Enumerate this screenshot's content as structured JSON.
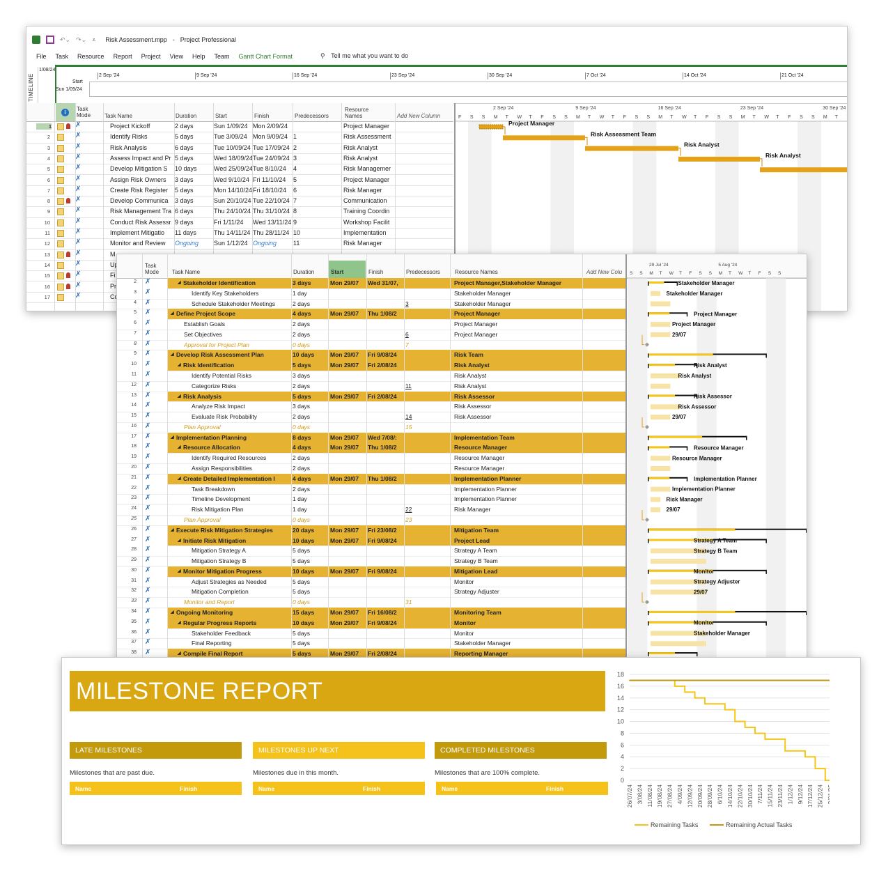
{
  "window1": {
    "doc_title": "Risk Assessment.mpp",
    "separator": "-",
    "app_title": "Project Professional",
    "menu": [
      "File",
      "Task",
      "Resource",
      "Report",
      "Project",
      "View",
      "Help",
      "Team",
      "Gantt Chart Format"
    ],
    "tell_me": "Tell me what you want to do",
    "timeline": {
      "side_label": "TIMELINE",
      "today_label": "1/08/24",
      "start_label": "Start",
      "start_date": "Sun 1/09/24",
      "dates": [
        "2 Sep '24",
        "9 Sep '24",
        "16 Sep '24",
        "23 Sep '24",
        "30 Sep '24",
        "7 Oct '24",
        "14 Oct '24",
        "21 Oct '24"
      ]
    },
    "columns": {
      "task_mode": "Task Mode",
      "task_name": "Task Name",
      "duration": "Duration",
      "start": "Start",
      "finish": "Finish",
      "predecessors": "Predecessors",
      "resource_names": "Resource Names",
      "add_new": "Add New Column"
    },
    "rows": [
      {
        "n": "1",
        "name": "Project Kickoff",
        "dur": "2 days",
        "start": "Sun 1/09/24",
        "finish": "Mon 2/09/24",
        "pred": "",
        "res": "Project Manager"
      },
      {
        "n": "2",
        "name": "Identify Risks",
        "dur": "5 days",
        "start": "Tue 3/09/24",
        "finish": "Mon 9/09/24",
        "pred": "1",
        "res": "Risk Assessment"
      },
      {
        "n": "3",
        "name": "Risk Analysis",
        "dur": "6 days",
        "start": "Tue 10/09/24",
        "finish": "Tue 17/09/24",
        "pred": "2",
        "res": "Risk Analyst"
      },
      {
        "n": "4",
        "name": "Assess Impact and Pr",
        "dur": "5 days",
        "start": "Wed 18/09/24",
        "finish": "Tue 24/09/24",
        "pred": "3",
        "res": "Risk Analyst"
      },
      {
        "n": "5",
        "name": "Develop Mitigation S",
        "dur": "10 days",
        "start": "Wed 25/09/24",
        "finish": "Tue 8/10/24",
        "pred": "4",
        "res": "Risk Managemer"
      },
      {
        "n": "6",
        "name": "Assign Risk Owners",
        "dur": "3 days",
        "start": "Wed 9/10/24",
        "finish": "Fri 11/10/24",
        "pred": "5",
        "res": "Project Manager"
      },
      {
        "n": "7",
        "name": "Create Risk Register",
        "dur": "5 days",
        "start": "Mon 14/10/24",
        "finish": "Fri 18/10/24",
        "pred": "6",
        "res": "Risk Manager"
      },
      {
        "n": "8",
        "name": "Develop Communica",
        "dur": "3 days",
        "start": "Sun 20/10/24",
        "finish": "Tue 22/10/24",
        "pred": "7",
        "res": "Communication"
      },
      {
        "n": "9",
        "name": "Risk Management Tra",
        "dur": "6 days",
        "start": "Thu 24/10/24",
        "finish": "Thu 31/10/24",
        "pred": "8",
        "res": "Training Coordin"
      },
      {
        "n": "10",
        "name": "Conduct Risk Assessr",
        "dur": "9 days",
        "start": "Fri 1/11/24",
        "finish": "Wed 13/11/24",
        "pred": "9",
        "res": "Workshop Facilit"
      },
      {
        "n": "11",
        "name": "Implement Mitigatio",
        "dur": "11 days",
        "start": "Thu 14/11/24",
        "finish": "Thu 28/11/24",
        "pred": "10",
        "res": "Implementation"
      },
      {
        "n": "12",
        "name": "Monitor and Review",
        "dur": "Ongoing",
        "start": "Sun 1/12/24",
        "finish": "Ongoing",
        "pred": "11",
        "res": "Risk Manager"
      },
      {
        "n": "13",
        "name": "M",
        "dur": "",
        "start": "",
        "finish": "",
        "pred": "",
        "res": ""
      },
      {
        "n": "14",
        "name": "Up",
        "dur": "",
        "start": "",
        "finish": "",
        "pred": "",
        "res": ""
      },
      {
        "n": "15",
        "name": "Fi",
        "dur": "",
        "start": "",
        "finish": "",
        "pred": "",
        "res": ""
      },
      {
        "n": "16",
        "name": "Pr",
        "dur": "",
        "start": "",
        "finish": "",
        "pred": "",
        "res": ""
      },
      {
        "n": "17",
        "name": "Co",
        "dur": "",
        "start": "",
        "finish": "",
        "pred": "",
        "res": ""
      }
    ],
    "gantt_weeks": [
      "2 Sep '24",
      "9 Sep '24",
      "16 Sep '24",
      "23 Sep '24",
      "30 Sep '24"
    ],
    "gantt_days": [
      "F",
      "S",
      "S",
      "M",
      "T",
      "W",
      "T",
      "F",
      "S",
      "S",
      "M",
      "T",
      "W",
      "T",
      "F",
      "S",
      "S",
      "M",
      "T",
      "W",
      "T",
      "F",
      "S",
      "S",
      "M",
      "T",
      "W",
      "T",
      "F",
      "S",
      "S",
      "M",
      "T",
      "W"
    ],
    "gantt_labels": [
      "Project Manager",
      "Risk Assessment Team",
      "Risk Analyst",
      "Risk Analyst"
    ]
  },
  "window2": {
    "columns": {
      "task_mode": "Task Mode",
      "task_name": "Task Name",
      "duration": "Duration",
      "start": "Start",
      "finish": "Finish",
      "predecessors": "Predecessors",
      "resource_names": "Resource Names",
      "add_new": "Add New Colu"
    },
    "gantt_weeks": [
      "29 Jul '24",
      "5 Aug '24"
    ],
    "gantt_days": [
      "S",
      "S",
      "M",
      "T",
      "W",
      "T",
      "F",
      "S",
      "S",
      "M",
      "T",
      "W",
      "T",
      "F",
      "S",
      "S"
    ],
    "rows": [
      {
        "n": "2",
        "name": "Stakeholder Identification",
        "dur": "3 days",
        "start": "Mon 29/07",
        "finish": "Wed 31/07,",
        "pred": "",
        "res": "Project Manager,Stakeholder Manager",
        "type": "sum",
        "lvl": 2
      },
      {
        "n": "3",
        "name": "Identify Key Stakeholders",
        "dur": "1 day",
        "start": "",
        "finish": "",
        "pred": "",
        "res": "Stakeholder Manager",
        "type": "task",
        "lvl": 3
      },
      {
        "n": "4",
        "name": "Schedule Stakeholder Meetings",
        "dur": "2 days",
        "start": "",
        "finish": "",
        "pred": "3",
        "res": "Stakeholder Manager",
        "type": "task",
        "lvl": 3
      },
      {
        "n": "5",
        "name": "Define Project Scope",
        "dur": "4 days",
        "start": "Mon 29/07",
        "finish": "Thu 1/08/2",
        "pred": "",
        "res": "Project Manager",
        "type": "sum",
        "lvl": 1
      },
      {
        "n": "6",
        "name": "Establish Goals",
        "dur": "2 days",
        "start": "",
        "finish": "",
        "pred": "",
        "res": "Project Manager",
        "type": "task",
        "lvl": 2
      },
      {
        "n": "7",
        "name": "Set Objectives",
        "dur": "2 days",
        "start": "",
        "finish": "",
        "pred": "6",
        "res": "Project Manager",
        "type": "task",
        "lvl": 2
      },
      {
        "n": "8",
        "name": "Approval for Project Plan",
        "dur": "0 days",
        "start": "",
        "finish": "",
        "pred": "7",
        "res": "",
        "type": "ms",
        "lvl": 1
      },
      {
        "n": "9",
        "name": "Develop Risk Assessment Plan",
        "dur": "10 days",
        "start": "Mon 29/07",
        "finish": "Fri 9/08/24",
        "pred": "",
        "res": "Risk Team",
        "type": "sum",
        "lvl": 1
      },
      {
        "n": "10",
        "name": "Risk Identification",
        "dur": "5 days",
        "start": "Mon 29/07",
        "finish": "Fri 2/08/24",
        "pred": "",
        "res": "Risk Analyst",
        "type": "sum",
        "lvl": 2
      },
      {
        "n": "11",
        "name": "Identify Potential Risks",
        "dur": "3 days",
        "start": "",
        "finish": "",
        "pred": "",
        "res": "Risk Analyst",
        "type": "task",
        "lvl": 3
      },
      {
        "n": "12",
        "name": "Categorize Risks",
        "dur": "2 days",
        "start": "",
        "finish": "",
        "pred": "11",
        "res": "Risk Analyst",
        "type": "task",
        "lvl": 3
      },
      {
        "n": "13",
        "name": "Risk Analysis",
        "dur": "5 days",
        "start": "Mon 29/07",
        "finish": "Fri 2/08/24",
        "pred": "",
        "res": "Risk Assessor",
        "type": "sum",
        "lvl": 2
      },
      {
        "n": "14",
        "name": "Analyze Risk Impact",
        "dur": "3 days",
        "start": "",
        "finish": "",
        "pred": "",
        "res": "Risk Assessor",
        "type": "task",
        "lvl": 3
      },
      {
        "n": "15",
        "name": "Evaluate Risk Probability",
        "dur": "2 days",
        "start": "",
        "finish": "",
        "pred": "14",
        "res": "Risk Assessor",
        "type": "task",
        "lvl": 3
      },
      {
        "n": "16",
        "name": "Plan Approval",
        "dur": "0 days",
        "start": "",
        "finish": "",
        "pred": "15",
        "res": "",
        "type": "ms",
        "lvl": 1
      },
      {
        "n": "17",
        "name": "Implementation Planning",
        "dur": "8 days",
        "start": "Mon 29/07",
        "finish": "Wed 7/08/:",
        "pred": "",
        "res": "Implementation Team",
        "type": "sum",
        "lvl": 1
      },
      {
        "n": "18",
        "name": "Resource Allocation",
        "dur": "4 days",
        "start": "Mon 29/07",
        "finish": "Thu 1/08/2",
        "pred": "",
        "res": "Resource Manager",
        "type": "sum",
        "lvl": 2
      },
      {
        "n": "19",
        "name": "Identify Required Resources",
        "dur": "2 days",
        "start": "",
        "finish": "",
        "pred": "",
        "res": "Resource Manager",
        "type": "task",
        "lvl": 3
      },
      {
        "n": "20",
        "name": "Assign Responsibilities",
        "dur": "2 days",
        "start": "",
        "finish": "",
        "pred": "",
        "res": "Resource Manager",
        "type": "task",
        "lvl": 3
      },
      {
        "n": "21",
        "name": "Create Detailed Implementation I",
        "dur": "4 days",
        "start": "Mon 29/07",
        "finish": "Thu 1/08/2",
        "pred": "",
        "res": "Implementation Planner",
        "type": "sum",
        "lvl": 2
      },
      {
        "n": "22",
        "name": "Task Breakdown",
        "dur": "2 days",
        "start": "",
        "finish": "",
        "pred": "",
        "res": "Implementation Planner",
        "type": "task",
        "lvl": 3
      },
      {
        "n": "23",
        "name": "Timeline Development",
        "dur": "1 day",
        "start": "",
        "finish": "",
        "pred": "",
        "res": "Implementation Planner",
        "type": "task",
        "lvl": 3
      },
      {
        "n": "24",
        "name": "Risk Mitigation Plan",
        "dur": "1 day",
        "start": "",
        "finish": "",
        "pred": "22",
        "res": "Risk Manager",
        "type": "task",
        "lvl": 3
      },
      {
        "n": "25",
        "name": "Plan Approval",
        "dur": "0 days",
        "start": "",
        "finish": "",
        "pred": "23",
        "res": "",
        "type": "ms",
        "lvl": 1
      },
      {
        "n": "26",
        "name": "Execute Risk Mitigation Strategies",
        "dur": "20 days",
        "start": "Mon 29/07",
        "finish": "Fri 23/08/2",
        "pred": "",
        "res": "Mitigation Team",
        "type": "sum",
        "lvl": 1
      },
      {
        "n": "27",
        "name": "Initiate Risk Mitigation",
        "dur": "10 days",
        "start": "Mon 29/07",
        "finish": "Fri 9/08/24",
        "pred": "",
        "res": "Project Lead",
        "type": "sum",
        "lvl": 2
      },
      {
        "n": "28",
        "name": "Mitigation Strategy A",
        "dur": "5 days",
        "start": "",
        "finish": "",
        "pred": "",
        "res": "Strategy A Team",
        "type": "task",
        "lvl": 3
      },
      {
        "n": "29",
        "name": "Mitigation Strategy B",
        "dur": "5 days",
        "start": "",
        "finish": "",
        "pred": "",
        "res": "Strategy B Team",
        "type": "task",
        "lvl": 3
      },
      {
        "n": "30",
        "name": "Monitor Mitigation Progress",
        "dur": "10 days",
        "start": "Mon 29/07",
        "finish": "Fri 9/08/24",
        "pred": "",
        "res": "Mitigation Lead",
        "type": "sum",
        "lvl": 2
      },
      {
        "n": "31",
        "name": "Adjust Strategies as Needed",
        "dur": "5 days",
        "start": "",
        "finish": "",
        "pred": "",
        "res": "Monitor",
        "type": "task",
        "lvl": 3
      },
      {
        "n": "32",
        "name": "Mitigation Completion",
        "dur": "5 days",
        "start": "",
        "finish": "",
        "pred": "",
        "res": "Strategy Adjuster",
        "type": "task",
        "lvl": 3
      },
      {
        "n": "33",
        "name": "Monitor and Report",
        "dur": "0 days",
        "start": "",
        "finish": "",
        "pred": "31",
        "res": "",
        "type": "ms",
        "lvl": 1
      },
      {
        "n": "34",
        "name": "Ongoing Monitoring",
        "dur": "15 days",
        "start": "Mon 29/07",
        "finish": "Fri 16/08/2",
        "pred": "",
        "res": "Monitoring Team",
        "type": "sum",
        "lvl": 1
      },
      {
        "n": "35",
        "name": "Regular Progress Reports",
        "dur": "10 days",
        "start": "Mon 29/07",
        "finish": "Fri 9/08/24",
        "pred": "",
        "res": "Monitor",
        "type": "sum",
        "lvl": 2
      },
      {
        "n": "36",
        "name": "Stakeholder Feedback",
        "dur": "5 days",
        "start": "",
        "finish": "",
        "pred": "",
        "res": "Monitor",
        "type": "task",
        "lvl": 3
      },
      {
        "n": "37",
        "name": "Final Reporting",
        "dur": "5 days",
        "start": "",
        "finish": "",
        "pred": "",
        "res": "Stakeholder Manager",
        "type": "task",
        "lvl": 3
      },
      {
        "n": "38",
        "name": "Compile Final Report",
        "dur": "5 days",
        "start": "Mon 29/07",
        "finish": "Fri 2/08/24",
        "pred": "",
        "res": "Reporting Manager",
        "type": "sum",
        "lvl": 2
      }
    ],
    "gantt_labels": [
      "Stakeholder Manager",
      "Stakeholder Manager",
      "",
      "Project Manager",
      "Project Manager",
      "29/07",
      "",
      "",
      "Risk Analyst",
      "Risk Analyst",
      "",
      "Risk Assessor",
      "Risk Assessor",
      "29/07",
      "",
      "",
      "Resource Manager",
      "Resource Manager",
      "",
      "Implementation Planner",
      "Implementation Planner",
      "Risk Manager",
      "29/07",
      "",
      "",
      "Strategy A Team",
      "Strategy B Team",
      "",
      "Monitor",
      "Strategy Adjuster",
      "29/07",
      "",
      "",
      "Monitor",
      "Stakeholder Manager",
      ""
    ]
  },
  "report": {
    "title": "MILESTONE REPORT",
    "sections": [
      {
        "title": "LATE MILESTONES",
        "desc": "Milestones that are past due.",
        "col1": "Name",
        "col2": "Finish",
        "color": "#c29a0c"
      },
      {
        "title": "MILESTONES UP NEXT",
        "desc": "Milestones due in this month.",
        "col1": "Name",
        "col2": "Finish",
        "color": "#f4c21a"
      },
      {
        "title": "COMPLETED MILESTONES",
        "desc": "Milestones that are 100% complete.",
        "col1": "Name",
        "col2": "Finish",
        "color": "#c29a0c"
      }
    ]
  },
  "chart_data": {
    "type": "line",
    "title": "",
    "xlabel": "",
    "ylabel": "",
    "ylim": [
      0,
      18
    ],
    "yticks": [
      0,
      2,
      4,
      6,
      8,
      10,
      12,
      14,
      16,
      18
    ],
    "grid": true,
    "legend_position": "bottom",
    "x": [
      "26/07/24",
      "3/08/24",
      "11/08/24",
      "19/08/24",
      "27/08/24",
      "4/09/24",
      "12/09/24",
      "20/09/24",
      "28/09/24",
      "6/10/24",
      "14/10/24",
      "22/10/24",
      "30/10/24",
      "7/11/24",
      "15/11/24",
      "23/11/24",
      "1/12/24",
      "9/12/24",
      "17/12/24",
      "25/12/24",
      "2/01/25"
    ],
    "series": [
      {
        "name": "Remaining Tasks",
        "color": "#f5c518",
        "values": [
          17,
          17,
          17,
          17,
          17,
          16,
          15,
          14,
          13,
          13,
          12,
          10,
          9,
          8,
          7,
          7,
          5,
          5,
          4,
          2,
          0
        ]
      },
      {
        "name": "Remaining Actual Tasks",
        "color": "#c29a0c",
        "values": [
          17,
          17,
          17,
          17,
          17,
          17,
          17,
          17,
          17,
          17,
          17,
          17,
          17,
          17,
          17,
          17,
          17,
          17,
          17,
          17,
          17
        ]
      }
    ]
  }
}
